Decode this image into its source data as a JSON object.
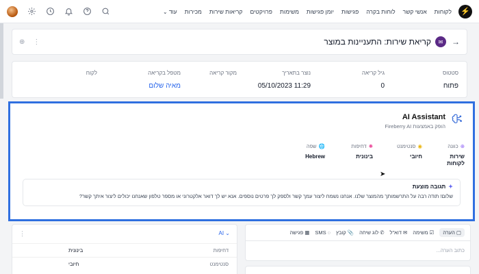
{
  "nav": {
    "items": [
      "לקוחות",
      "אנשי קשר",
      "לוחות בקרה",
      "פגישות",
      "יומן פגישות",
      "משימות",
      "פרויקטים",
      "קריאות שירות",
      "מכירות"
    ],
    "more": "עוד"
  },
  "header": {
    "title": "קריאת שירות: התעניינות במוצר"
  },
  "fields": [
    {
      "label": "סטטוס",
      "value": "פתוח"
    },
    {
      "label": "גיל קריאה",
      "value": "0"
    },
    {
      "label": "נוצר בתאריך",
      "value": "05/10/2023 11:29"
    },
    {
      "label": "מקור קריאה",
      "value": ""
    },
    {
      "label": "מטפל בקריאה",
      "value": "מאיה שלום"
    },
    {
      "label": "לקוח",
      "value": ""
    }
  ],
  "ai": {
    "title": "AI Assistant",
    "subtitle": "הופק באמצעות Fireberry AI",
    "attributes": [
      {
        "label": "כוונה",
        "value": "שירות לקוחות"
      },
      {
        "label": "סנטימנט",
        "value": "חיובי"
      },
      {
        "label": "דחיפות",
        "value": "בינונית"
      },
      {
        "label": "שפה",
        "value": "Hebrew"
      }
    ],
    "suggestion_title": "תגובה מוצעת",
    "suggestion_text": "שלום! תודה רבה על התרשמותך מהמוצר שלנו. אנחנו נשמח ליצור עמך קשר ולספק לך פרטים נוספים. אנא יש לך דואר אלקטרוני או מספר טלפון שאנחנו יכולים ליצור איתך קשר?"
  },
  "activity": {
    "tabs": [
      "הערה",
      "משימה",
      "דוא\"ל",
      "לוג שיחה",
      "קובץ",
      "SMS",
      "פגישה"
    ],
    "placeholder": "כתוב הערה..."
  },
  "sidepanel": {
    "selector": "AI",
    "rows": [
      {
        "label": "דחיפות",
        "value": "בינונית"
      },
      {
        "label": "סנטימנט",
        "value": "חיובי"
      }
    ]
  }
}
